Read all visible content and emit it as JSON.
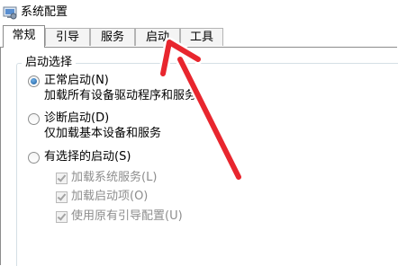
{
  "window": {
    "title": "系统配置"
  },
  "tabs": [
    {
      "label": "常规"
    },
    {
      "label": "引导"
    },
    {
      "label": "服务"
    },
    {
      "label": "启动"
    },
    {
      "label": "工具"
    }
  ],
  "startup_selection": {
    "group_title": "启动选择",
    "normal_startup": {
      "label": "正常启动(N)",
      "description": "加载所有设备驱动程序和服务",
      "checked": true
    },
    "diagnostic_startup": {
      "label": "诊断启动(D)",
      "description": "仅加载基本设备和服务",
      "checked": false
    },
    "selective_startup": {
      "label": "有选择的启动(S)",
      "checked": false,
      "options": [
        {
          "label": "加载系统服务(L)",
          "checked": true,
          "disabled": true
        },
        {
          "label": "加载启动项(O)",
          "checked": true,
          "disabled": true
        },
        {
          "label": "使用原有引导配置(U)",
          "checked": true,
          "disabled": true
        }
      ]
    }
  },
  "colors": {
    "annotation_arrow": "#e8262e",
    "tab_border": "#8c8c8c"
  }
}
